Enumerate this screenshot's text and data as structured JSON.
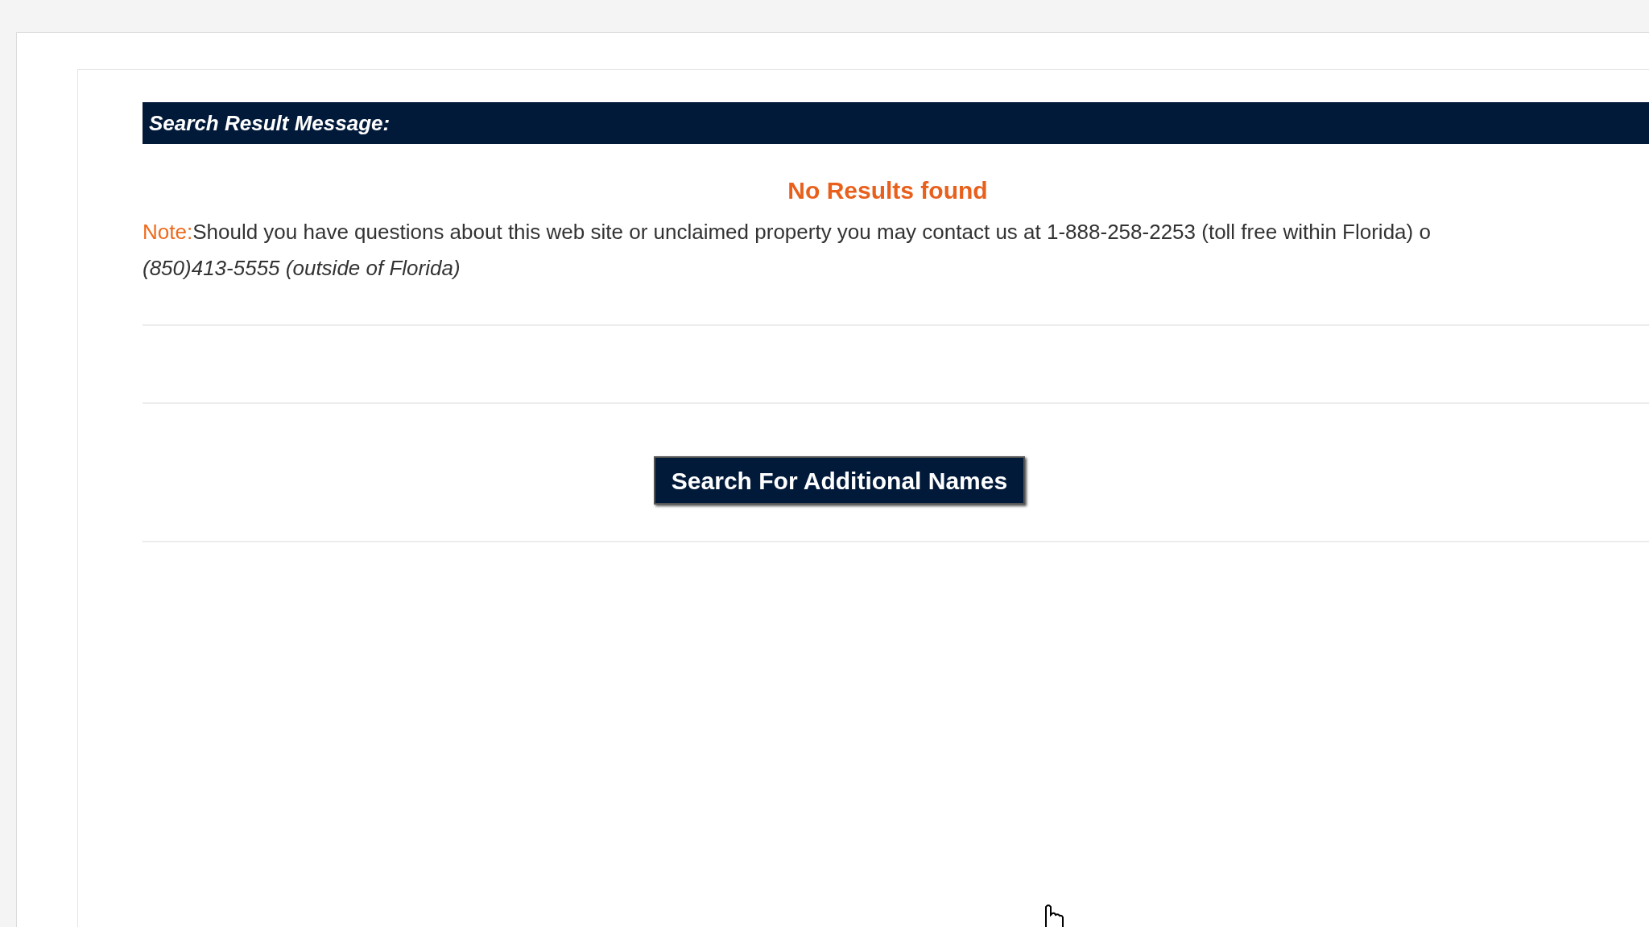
{
  "header": {
    "title": "Search Result Message:"
  },
  "message": "No Results found",
  "note": {
    "label": "Note:",
    "line_1": "Should you have questions about this web site or unclaimed property you may contact us at 1-888-258-2253 (toll free within Florida) o",
    "line_2": "(850)413-5555 (outside of Florida)"
  },
  "button": {
    "label": "Search For Additional Names"
  }
}
